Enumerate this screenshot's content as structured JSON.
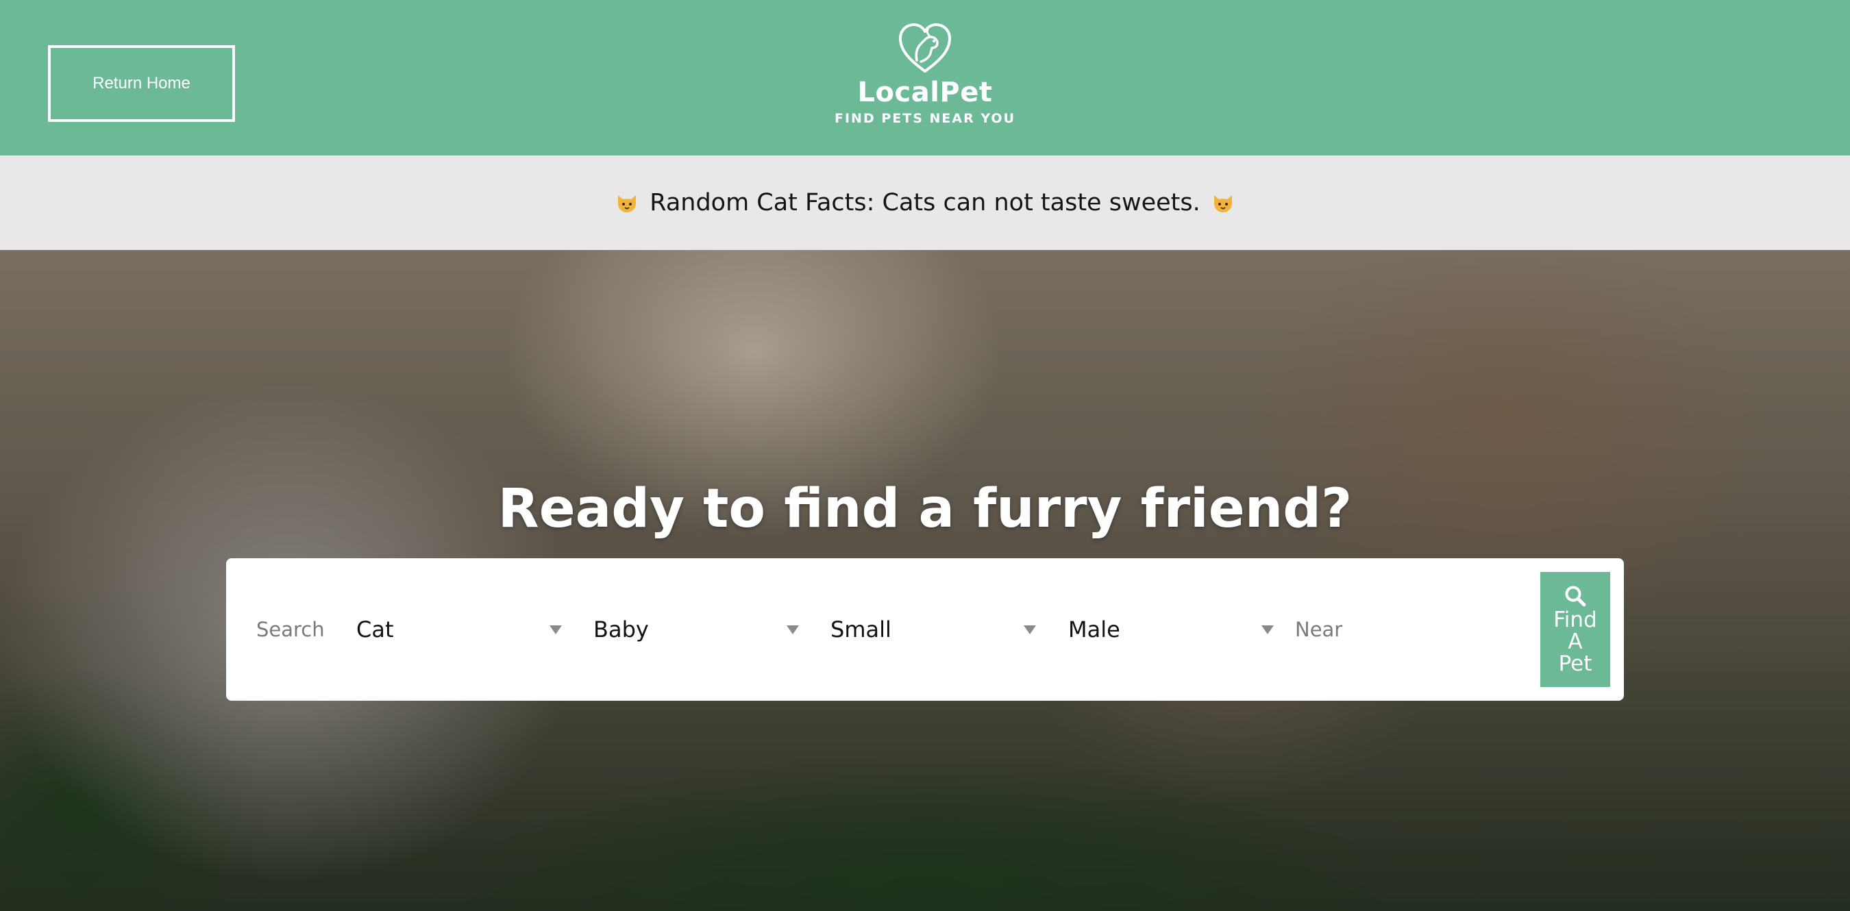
{
  "header": {
    "return_home_label": "Return Home",
    "logo": {
      "name": "LocalPet",
      "tagline": "FIND PETS NEAR YOU",
      "icon": "heart-pet-icon"
    }
  },
  "fact_bar": {
    "text": "Random Cat Facts: Cats can not taste sweets.",
    "icon": "cat-face-icon"
  },
  "hero": {
    "title": "Ready to find a furry friend?"
  },
  "search": {
    "label": "Search",
    "filters": [
      {
        "name": "type",
        "value": "Cat"
      },
      {
        "name": "age",
        "value": "Baby"
      },
      {
        "name": "size",
        "value": "Small"
      },
      {
        "name": "gender",
        "value": "Male"
      }
    ],
    "near_placeholder": "Near",
    "button_label": "Find A Pet",
    "button_icon": "search-icon"
  },
  "colors": {
    "brand_green": "#6bb996",
    "fact_bar_bg": "#e8e8e8",
    "panel_bg": "#ffffff"
  }
}
